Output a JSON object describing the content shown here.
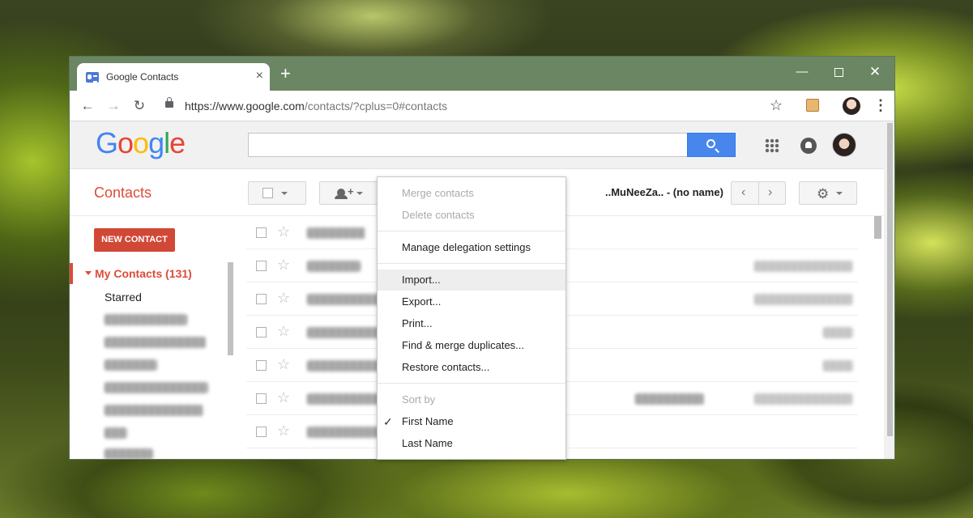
{
  "browser": {
    "tab_title": "Google Contacts",
    "tab_close": "×",
    "new_tab": "+",
    "url_main": "https://www.google.com",
    "url_rest": "/contacts/?cplus=0#contacts",
    "window_min": "—",
    "window_close": "✕",
    "nav_back": "←",
    "nav_forward": "→",
    "nav_reload": "↻",
    "star": "☆",
    "menu": "⋮"
  },
  "header": {
    "logo": [
      "G",
      "o",
      "o",
      "g",
      "l",
      "e"
    ],
    "search_placeholder": ""
  },
  "actionbar": {
    "title": "Contacts",
    "contact_name": "..MuNeeZa.. - (no name)",
    "pager_prev": "‹",
    "pager_next": "›",
    "settings_icon": "⚙"
  },
  "sidebar": {
    "new_contact": "NEW CONTACT",
    "my_contacts": "My Contacts (131)",
    "starred": "Starred"
  },
  "dropdown": {
    "items": [
      {
        "label": "Merge contacts",
        "disabled": true
      },
      {
        "label": "Delete contacts",
        "disabled": true
      },
      {
        "label": "Manage delegation settings",
        "disabled": false
      },
      {
        "label": "Import...",
        "disabled": false,
        "hover": true
      },
      {
        "label": "Export...",
        "disabled": false
      },
      {
        "label": "Print...",
        "disabled": false
      },
      {
        "label": "Find & merge duplicates...",
        "disabled": false
      },
      {
        "label": "Restore contacts...",
        "disabled": false
      },
      {
        "label": "Sort by",
        "disabled": true
      },
      {
        "label": "First Name",
        "disabled": false,
        "checked": true
      },
      {
        "label": "Last Name",
        "disabled": false
      }
    ],
    "check_glyph": "✓"
  },
  "colors": {
    "brand_red": "#dd4b39",
    "button_red": "#d14836",
    "search_blue": "#4787ed",
    "titlebar": "#6a8662"
  }
}
